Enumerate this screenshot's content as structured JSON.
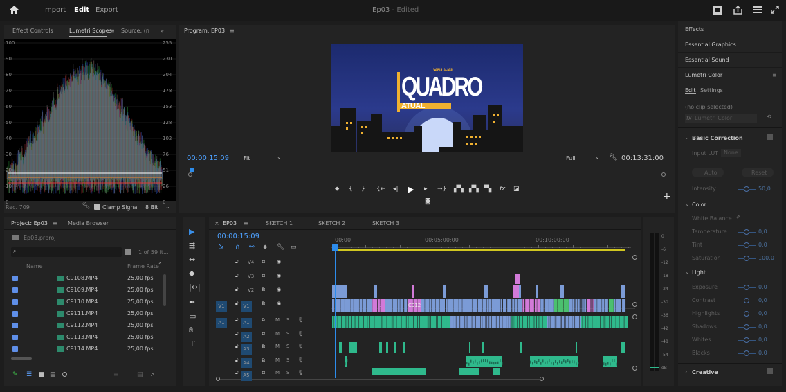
{
  "topbar": {
    "workspaces": [
      "Import",
      "Edit",
      "Export"
    ],
    "title": "Ep03",
    "status": "- Edited"
  },
  "scopes": {
    "tabs": [
      "Effect Controls",
      "Lumetri Scopes",
      "Source: (n"
    ],
    "left_scale": [
      "100",
      "90",
      "80",
      "70",
      "60",
      "50",
      "40",
      "30",
      "20",
      "10",
      "0"
    ],
    "right_scale": [
      "255",
      "230",
      "204",
      "178",
      "153",
      "128",
      "102",
      "76",
      "51",
      "26",
      "0"
    ],
    "colorspace": "Rec. 709",
    "clamp_label": "Clamp Signal",
    "bit_depth": "8 Bit"
  },
  "program": {
    "tab": "Program: EP03",
    "timecode": "00:00:15:09",
    "fit": "Fit",
    "quality": "Full",
    "duration": "00:13:31:00",
    "frame": {
      "brand_small": "VARIS ALIAS",
      "title_top": "QUADRO",
      "title_bottom": "ATUAL"
    }
  },
  "project": {
    "tabs": [
      "Project: Ep03",
      "Media Browser"
    ],
    "file": "Ep03.prproj",
    "count": "1 of 59 it...",
    "columns": {
      "name": "Name",
      "frame_rate": "Frame Rate"
    },
    "items": [
      {
        "name": "C9108.MP4",
        "fps": "25,00 fps"
      },
      {
        "name": "C9109.MP4",
        "fps": "25,00 fps"
      },
      {
        "name": "C9110.MP4",
        "fps": "25,00 fps"
      },
      {
        "name": "C9111.MP4",
        "fps": "25,00 fps"
      },
      {
        "name": "C9112.MP4",
        "fps": "25,00 fps"
      },
      {
        "name": "C9113.MP4",
        "fps": "25,00 fps"
      },
      {
        "name": "C9114.MP4",
        "fps": "25,00 fps"
      }
    ]
  },
  "timeline": {
    "tabs": [
      "EP03",
      "SKETCH 1",
      "SKETCH 2",
      "SKETCH 3"
    ],
    "timecode": "00:00:15:09",
    "ruler": [
      "00:00",
      "00:05:00:00",
      "00:10:00:00"
    ],
    "video_tracks": [
      "V4",
      "V3",
      "V2",
      "V1"
    ],
    "audio_tracks": [
      "A1",
      "A2",
      "A3",
      "A4",
      "A5"
    ],
    "v1_source": "V1",
    "a1_source": "A1",
    "clip_label": "C912",
    "fx_label": "fx",
    "m_label": "M",
    "s_label": "S"
  },
  "meter": {
    "scale": [
      "0",
      "-6",
      "-12",
      "-18",
      "-24",
      "-30",
      "-36",
      "-42",
      "-48",
      "-54",
      "dB"
    ]
  },
  "right_panel": {
    "items": [
      "Effects",
      "Essential Graphics",
      "Essential Sound",
      "Lumetri Color"
    ],
    "subtabs": [
      "Edit",
      "Settings"
    ],
    "no_clip": "(no clip selected)",
    "lumetri_dropdown": "Lumetri Color",
    "basic_correction": "Basic Correction",
    "input_lut_label": "Input LUT",
    "input_lut_value": "None",
    "auto": "Auto",
    "reset": "Reset",
    "intensity_label": "Intensity",
    "intensity_value": "50,0",
    "color": "Color",
    "white_balance": "White Balance",
    "color_rows": [
      {
        "label": "Temperature",
        "value": "0,0"
      },
      {
        "label": "Tint",
        "value": "0,0"
      },
      {
        "label": "Saturation",
        "value": "100,0"
      }
    ],
    "light": "Light",
    "light_rows": [
      {
        "label": "Exposure",
        "value": "0,0"
      },
      {
        "label": "Contrast",
        "value": "0,0"
      },
      {
        "label": "Highlights",
        "value": "0,0"
      },
      {
        "label": "Shadows",
        "value": "0,0"
      },
      {
        "label": "Whites",
        "value": "0,0"
      },
      {
        "label": "Blacks",
        "value": "0,0"
      }
    ],
    "creative": "Creative"
  },
  "colors": {
    "accent": "#2d8ceb",
    "video_clip": "#7b9bd6",
    "pink_clip": "#d27ad8",
    "audio_clip": "#2fb98c",
    "playhead": "#2d8ceb"
  }
}
